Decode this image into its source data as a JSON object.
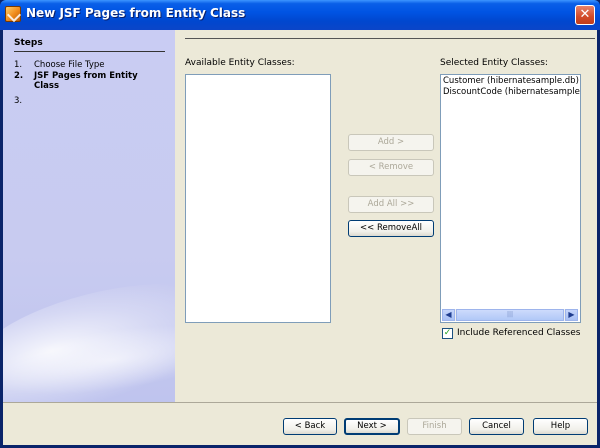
{
  "window": {
    "title": "New JSF Pages from Entity Class",
    "close_glyph": "✕"
  },
  "steps": {
    "heading": "Steps",
    "items": [
      {
        "num": "1.",
        "label": "Choose File Type",
        "current": false
      },
      {
        "num": "2.",
        "label": "JSF Pages from Entity Class",
        "current": true
      },
      {
        "num": "3.",
        "label": "",
        "current": false
      }
    ]
  },
  "available": {
    "label": "Available Entity Classes:",
    "items": []
  },
  "selected": {
    "label": "Selected Entity Classes:",
    "items": [
      "Customer (hibernatesample.db)",
      "DiscountCode (hibernatesample.db)"
    ]
  },
  "transfer_buttons": {
    "add": "Add >",
    "remove": "< Remove",
    "add_all": "Add All >>",
    "remove_all": "<< RemoveAll"
  },
  "include_referenced": {
    "label": "Include Referenced Classes",
    "checked": true,
    "glyph": "✓"
  },
  "scrollbar": {
    "left_glyph": "◀",
    "right_glyph": "▶",
    "grip_glyph": "|||"
  },
  "footer_buttons": {
    "back": "< Back",
    "next": "Next >",
    "finish": "Finish",
    "cancel": "Cancel",
    "help": "Help"
  },
  "colors": {
    "titlebar": "#0054e3",
    "steps_panel": "#c9ccf3",
    "dialog_bg": "#ece9d8"
  }
}
